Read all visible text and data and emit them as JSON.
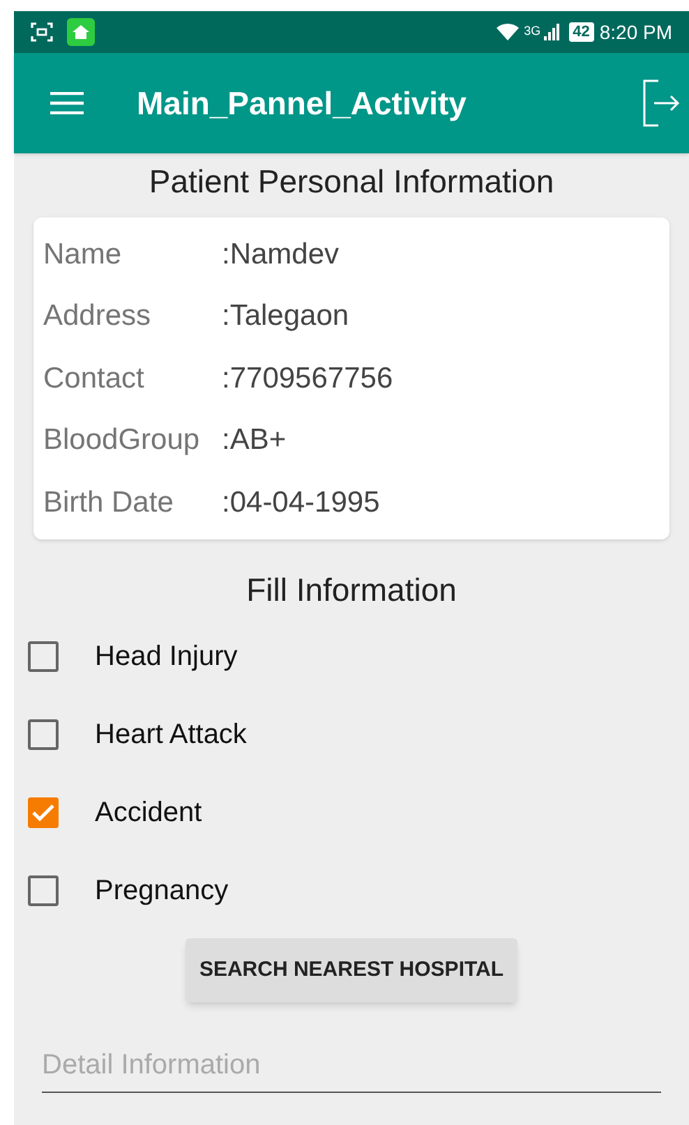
{
  "status_bar": {
    "network": "3G",
    "battery": "42",
    "time": "8:20 PM"
  },
  "app_bar": {
    "title": "Main_Pannel_Activity"
  },
  "patient_section": {
    "title": "Patient Personal Information",
    "fields": [
      {
        "label": "Name",
        "value": ":Namdev"
      },
      {
        "label": "Address",
        "value": ":Talegaon"
      },
      {
        "label": "Contact",
        "value": ":7709567756"
      },
      {
        "label": "BloodGroup",
        "value": ":AB+"
      },
      {
        "label": "Birth Date",
        "value": ":04-04-1995"
      }
    ]
  },
  "fill_section": {
    "title": "Fill Information",
    "options": [
      {
        "label": "Head Injury",
        "checked": false
      },
      {
        "label": "Heart Attack",
        "checked": false
      },
      {
        "label": "Accident",
        "checked": true
      },
      {
        "label": "Pregnancy",
        "checked": false
      }
    ]
  },
  "search_button": "SEARCH NEAREST HOSPITAL",
  "detail_field": {
    "placeholder": "Detail Information"
  }
}
